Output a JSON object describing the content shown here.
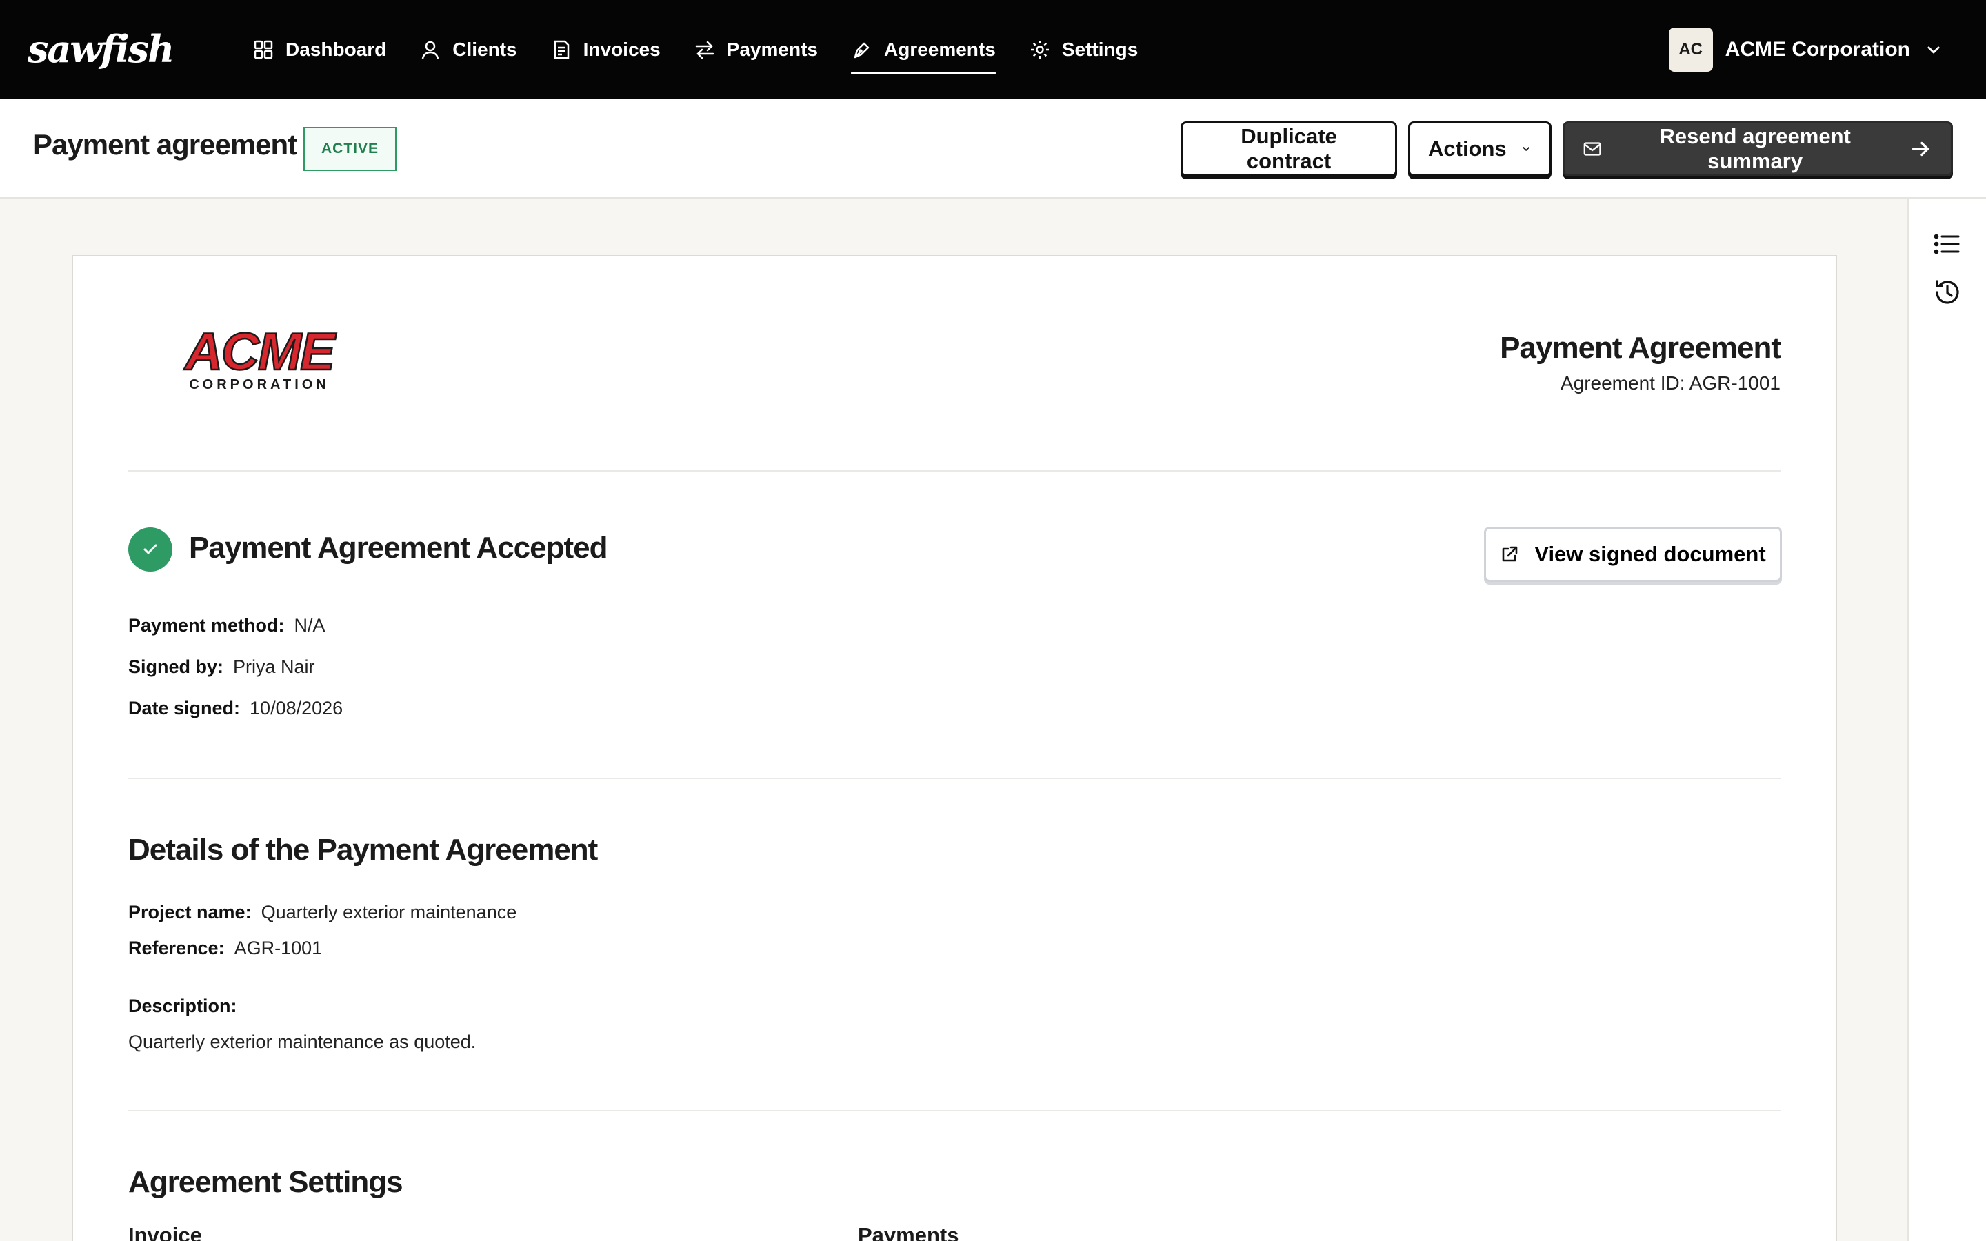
{
  "nav": {
    "logo_text": "sawfish",
    "items": [
      {
        "label": "Dashboard",
        "icon": "grid-icon"
      },
      {
        "label": "Clients",
        "icon": "user-icon"
      },
      {
        "label": "Invoices",
        "icon": "invoice-icon"
      },
      {
        "label": "Payments",
        "icon": "swap-arrows-icon"
      },
      {
        "label": "Agreements",
        "icon": "pen-icon",
        "active": true
      },
      {
        "label": "Settings",
        "icon": "gear-icon"
      }
    ],
    "org": {
      "initials": "AC",
      "name": "ACME Corporation"
    }
  },
  "header": {
    "title": "Payment agreement",
    "status": "ACTIVE",
    "duplicate_label": "Duplicate contract",
    "actions_label": "Actions",
    "resend_label": "Resend agreement summary"
  },
  "document": {
    "logo_main": "ACME",
    "logo_sub": "CORPORATION",
    "title": "Payment Agreement",
    "agreement_id": "Agreement ID: AGR-1001",
    "accepted_title": "Payment Agreement Accepted",
    "view_signed_label": "View signed document",
    "acceptance": {
      "payment_method_label": "Payment method:",
      "payment_method": "N/A",
      "signed_by_label": "Signed by:",
      "signed_by": "Priya Nair",
      "date_signed_label": "Date signed:",
      "date_signed": "10/08/2026"
    },
    "details_title": "Details of the Payment Agreement",
    "details": {
      "project_name_label": "Project name:",
      "project_name": "Quarterly exterior maintenance",
      "reference_label": "Reference:",
      "reference": "AGR-1001",
      "description_label": "Description:",
      "description": "Quarterly exterior maintenance as quoted."
    },
    "settings_title": "Agreement Settings",
    "settings_invoice_label": "Invoice",
    "settings_payments_label": "Payments"
  },
  "colors": {
    "nav_bg": "#050505",
    "accent_green": "#2e9a64",
    "acme_red": "#d6262e",
    "page_bg": "#f7f6f3"
  }
}
